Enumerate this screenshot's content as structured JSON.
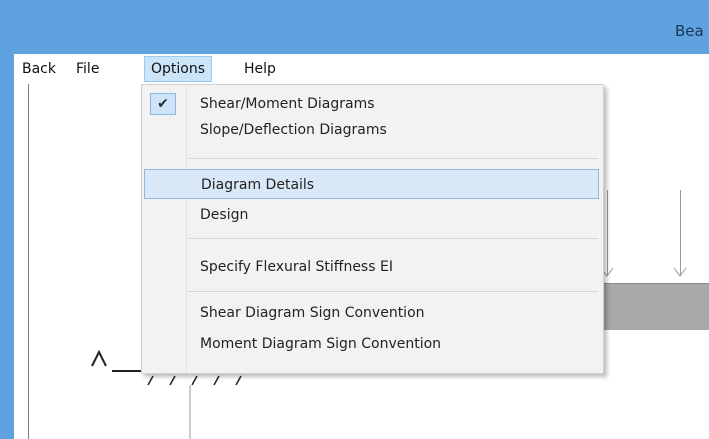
{
  "window": {
    "title": "Bea"
  },
  "menubar": {
    "items": [
      {
        "label": "Back"
      },
      {
        "label": "File"
      },
      {
        "label": "Options"
      },
      {
        "label": "Help"
      }
    ]
  },
  "options_menu": {
    "items": [
      {
        "label": "Shear/Moment Diagrams",
        "checked": true
      },
      {
        "label": "Slope/Deflection Diagrams"
      },
      {
        "label": "Diagram Details",
        "highlighted": true
      },
      {
        "label": "Design"
      },
      {
        "label": "Specify Flexural Stiffness EI"
      },
      {
        "label": "Shear Diagram Sign Convention"
      },
      {
        "label": "Moment Diagram Sign Convention"
      }
    ],
    "check_glyph": "✔"
  },
  "icons": {
    "check": "checkmark-icon"
  },
  "colors": {
    "titlebar": "#5fa2df",
    "highlight": "#d9e8f7",
    "beam": "#a9a9a9"
  }
}
